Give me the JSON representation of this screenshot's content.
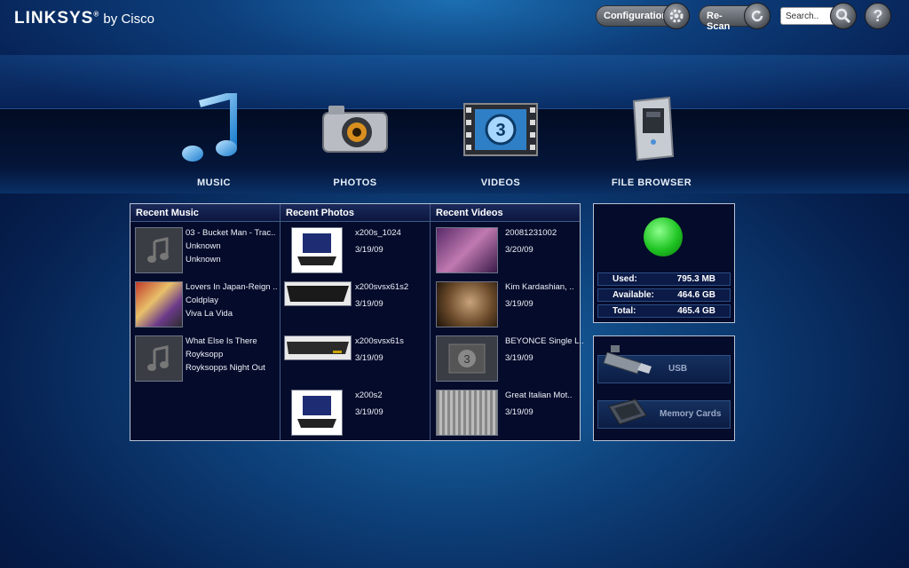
{
  "header": {
    "logo_brand": "LINKSYS",
    "logo_reg": "®",
    "logo_sub": " by Cisco",
    "config_label": "Configuration",
    "config_icon": "gear-icon",
    "rescan_label": "Re-Scan",
    "rescan_icon": "refresh-icon",
    "search_placeholder": "Search..",
    "search_icon": "magnifier-icon",
    "help_icon": "question-icon",
    "help_glyph": "?"
  },
  "nav": {
    "music": "MUSIC",
    "photos": "PHOTOS",
    "videos": "VIDEOS",
    "file_browser": "FILE BROWSER"
  },
  "recent": {
    "music_header": "Recent Music",
    "photos_header": "Recent Photos",
    "videos_header": "Recent Videos",
    "music": [
      {
        "title": "03 - Bucket Man - Trac..",
        "artist": "Unknown",
        "album": "Unknown"
      },
      {
        "title": "Lovers In Japan-Reign ..",
        "artist": "Coldplay",
        "album": "Viva La Vida"
      },
      {
        "title": "What Else Is There",
        "artist": "Royksopp",
        "album": "Royksopps Night Out"
      }
    ],
    "photos": [
      {
        "name": "x200s_1024",
        "date": "3/19/09"
      },
      {
        "name": "x200svsx61s2",
        "date": "3/19/09"
      },
      {
        "name": "x200svsx61s",
        "date": "3/19/09"
      },
      {
        "name": "x200s2",
        "date": "3/19/09"
      }
    ],
    "videos": [
      {
        "name": "20081231002",
        "date": "3/20/09"
      },
      {
        "name": "Kim Kardashian, ..",
        "date": "3/19/09"
      },
      {
        "name": "BEYONCE Single L..",
        "date": "3/19/09"
      },
      {
        "name": "Great Italian Mot..",
        "date": "3/19/09"
      }
    ]
  },
  "storage": {
    "status_color": "#1fc423",
    "used_label": "Used:",
    "used_value": "795.3 MB",
    "available_label": "Available:",
    "available_value": "464.6 GB",
    "total_label": "Total:",
    "total_value": "465.4 GB"
  },
  "devices": {
    "usb": "USB",
    "memory_cards": "Memory Cards"
  }
}
